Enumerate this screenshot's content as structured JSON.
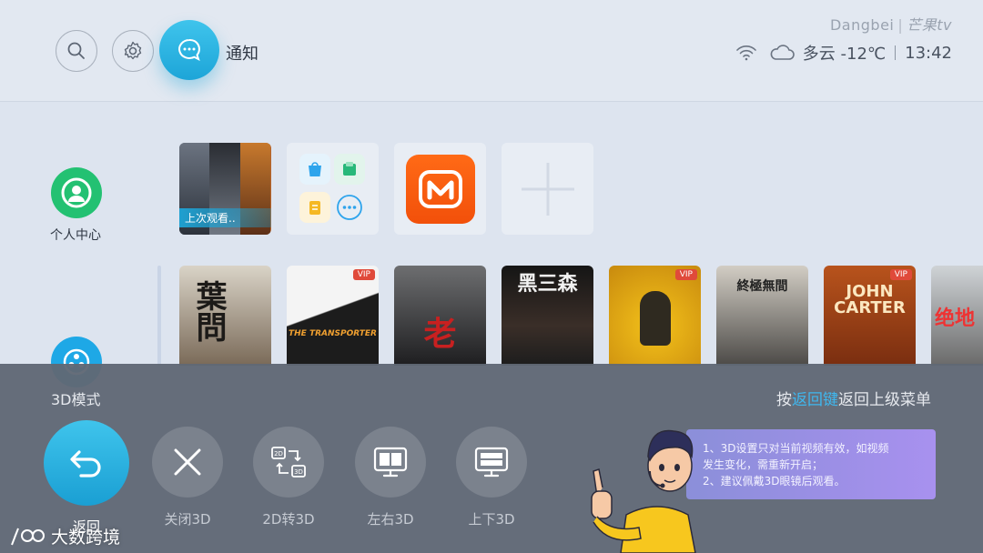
{
  "header": {
    "notify_label": "通知",
    "brand_left": "Dangbei",
    "brand_right": "芒果tv",
    "weather": "多云 -12℃",
    "time": "13:42"
  },
  "sidebar": {
    "user_center_label": "个人中心"
  },
  "tiles": {
    "recent_label": "上次观看.."
  },
  "posters": [
    {
      "title": "葉問",
      "vip": false
    },
    {
      "title": "THE TRANSPORTER",
      "vip": true
    },
    {
      "title": "老",
      "vip": false
    },
    {
      "title": "黑三森",
      "vip": false
    },
    {
      "title": "",
      "vip": true
    },
    {
      "title": "終極無間",
      "vip": false
    },
    {
      "title": "JOHN CARTER",
      "vip": true
    },
    {
      "title": "绝地",
      "vip": false
    }
  ],
  "panel": {
    "title": "3D模式",
    "hint_prefix": "按",
    "hint_key": "返回键",
    "hint_suffix": "返回上级菜单",
    "options": [
      {
        "label": "返回",
        "icon": "back-arrow-icon"
      },
      {
        "label": "关闭3D",
        "icon": "close-icon"
      },
      {
        "label": "2D转3D",
        "icon": "convert-2d-3d-icon"
      },
      {
        "label": "左右3D",
        "icon": "side-by-side-icon"
      },
      {
        "label": "上下3D",
        "icon": "top-bottom-icon"
      }
    ],
    "tip_line1": "1、3D设置只对当前视频有效，如视频",
    "tip_line2": "发生变化，需重新开启；",
    "tip_line3": "2、建议佩戴3D眼镜后观看。"
  },
  "watermark": "大数跨境",
  "colors": {
    "accent": "#1da5d8",
    "user_green": "#23c172",
    "mango_orange": "#ff5f0f",
    "vip_red": "#e04a3a",
    "panel_bg": "#606875",
    "tip_purple": "#9c8fe6"
  }
}
